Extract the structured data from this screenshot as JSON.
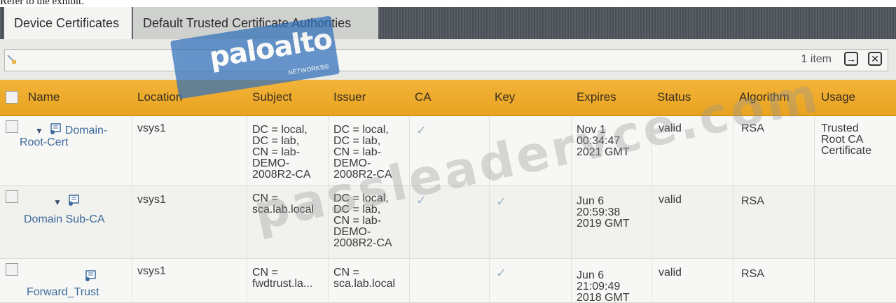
{
  "caption": "Refer to the exhibit.",
  "tabs": [
    {
      "label": "Device Certificates",
      "active": true
    },
    {
      "label": "Default Trusted Certificate Authorities",
      "active": false
    }
  ],
  "toolbar": {
    "item_count": "1 item",
    "apply_icon": "arrow-right-icon",
    "clear_icon": "close-icon"
  },
  "columns": [
    "Name",
    "Location",
    "Subject",
    "Issuer",
    "CA",
    "Key",
    "Expires",
    "Status",
    "Algorithm",
    "Usage"
  ],
  "rows": [
    {
      "name_line1": "Domain-",
      "name_line2": "Root-Cert",
      "location": "vsys1",
      "subject": [
        "DC = local,",
        "DC = lab,",
        "CN = lab-",
        "DEMO-",
        "2008R2-CA"
      ],
      "issuer": [
        "DC = local,",
        "DC = lab,",
        "CN = lab-",
        "DEMO-",
        "2008R2-CA"
      ],
      "ca": true,
      "key": false,
      "expires": [
        "Nov 1",
        "00:34:47",
        "2021 GMT"
      ],
      "status": "valid",
      "algorithm": "RSA",
      "usage": [
        "Trusted",
        "Root CA",
        "Certificate"
      ]
    },
    {
      "name_line1": "",
      "name_line2": "Domain Sub-CA",
      "location": "vsys1",
      "subject": [
        "CN =",
        "sca.lab.local"
      ],
      "issuer": [
        "DC = local,",
        "DC = lab,",
        "CN = lab-",
        "DEMO-",
        "2008R2-CA"
      ],
      "ca": true,
      "key": true,
      "expires": [
        "Jun 6",
        "20:59:38",
        "2019 GMT"
      ],
      "status": "valid",
      "algorithm": "RSA",
      "usage": []
    },
    {
      "name_line1": "",
      "name_line2": "Forward_Trust",
      "location": "vsys1",
      "subject": [
        "CN =",
        "fwdtrust.la..."
      ],
      "issuer": [
        "CN =",
        "sca.lab.local"
      ],
      "ca": false,
      "key": true,
      "expires": [
        "Jun 6",
        "21:09:49",
        "2018 GMT"
      ],
      "status": "valid",
      "algorithm": "RSA",
      "usage": []
    }
  ],
  "watermark": {
    "logo": "paloalto",
    "logo_sub": "NETWORKS®",
    "site": "passleadervce.com"
  },
  "colors": {
    "header": "#f0ad2e",
    "link": "#3d6a9b",
    "tab_bar": "#54585f"
  }
}
